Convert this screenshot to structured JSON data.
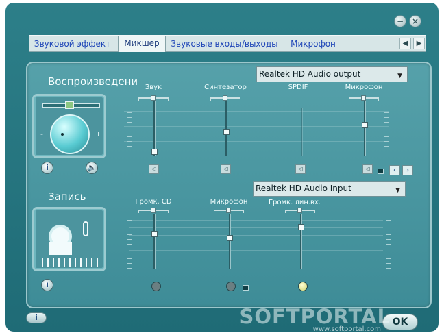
{
  "tabs": [
    "Звуковой эффект",
    "Микшер",
    "Звуковые входы/выходы",
    "Микрофон"
  ],
  "playback": {
    "title": "Воспроизведени",
    "device": "Realtek HD Audio output",
    "channels": [
      {
        "label": "Звук",
        "level": 0.0
      },
      {
        "label": "Синтезатор",
        "level": 0.45
      },
      {
        "label": "SPDIF",
        "level": null
      },
      {
        "label": "Микрофон",
        "level": 0.55
      }
    ]
  },
  "recording": {
    "title": "Запись",
    "device": "Realtek HD Audio Input",
    "channels": [
      {
        "label": "Громк. CD",
        "level": 0.65
      },
      {
        "label": "Микрофон",
        "level": 0.55
      },
      {
        "label": "Громк. лин.вх.",
        "level": 0.75
      }
    ]
  },
  "controls": {
    "ok_label": "OK",
    "info_label": "i"
  },
  "watermark": {
    "brand": "SOFTPORTAL",
    "site": "www.softportal.com"
  },
  "colors": {
    "window": "#1f6b76",
    "panel": "#4c949e",
    "accent": "#9ccbd0",
    "tab_text": "#2047b8"
  },
  "icons": [
    "minimize-icon",
    "close-icon",
    "speaker-icon",
    "microphone-icon",
    "headset-icon",
    "info-icon",
    "chevron-left-icon",
    "chevron-right-icon"
  ]
}
